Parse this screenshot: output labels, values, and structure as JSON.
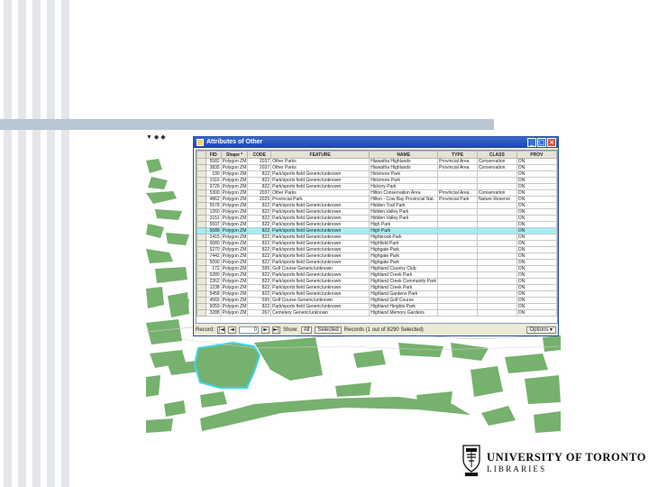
{
  "slide": {
    "colors": {
      "stripe": "#e3e6ea",
      "bar": "#b9c6d3",
      "map_fill": "#76b16e",
      "selection": "#3fd6e6"
    }
  },
  "map": {
    "toolbar_text": "▼ ◆ ◆"
  },
  "attr_window": {
    "title": "Attributes of Other",
    "buttons": {
      "minimize": "_",
      "maximize": "□",
      "close": "×"
    },
    "columns": [
      "FID",
      "Shape *",
      "CODE",
      "FEATURE",
      "NAME",
      "TYPE",
      "CLASS",
      "PROV"
    ],
    "rows": [
      [
        "5582",
        "Polygon ZM",
        "2037",
        "Other Parks",
        "Hiawatha Highlands",
        "Provincial Area",
        "Conservation",
        "ON"
      ],
      [
        "3835",
        "Polygon ZM",
        "2037",
        "Other Parks",
        "Hiawatha Highlands",
        "Provincial Area",
        "Conservation",
        "ON"
      ],
      [
        "190",
        "Polygon ZM",
        "822",
        "Park/sports field Generic/unknown",
        "Hickmore Park",
        "",
        "",
        "ON"
      ],
      [
        "3116",
        "Polygon ZM",
        "822",
        "Park/sports field Generic/unknown",
        "Hickmore Park",
        "",
        "",
        "ON"
      ],
      [
        "3726",
        "Polygon ZM",
        "822",
        "Park/sports field Generic/unknown",
        "Hickory Park",
        "",
        "",
        "ON"
      ],
      [
        "5300",
        "Polygon ZM",
        "2037",
        "Other Parks",
        "Hilton Conservation Area",
        "Provincial Area",
        "Conservation",
        "ON"
      ],
      [
        "4862",
        "Polygon ZM",
        "2025",
        "Provincial Park",
        "Hilton - Cow Bay Provincial Nat.",
        "Provincial Park",
        "Nature Reserve",
        "ON"
      ],
      [
        "5578",
        "Polygon ZM",
        "822",
        "Park/sports field Generic/unknown",
        "Hidden Trail Park",
        "",
        "",
        "ON"
      ],
      [
        "1260",
        "Polygon ZM",
        "822",
        "Park/sports field Generic/unknown",
        "Hidden Valley Park",
        "",
        "",
        "ON"
      ],
      [
        "3151",
        "Polygon ZM",
        "822",
        "Park/sports field Generic/unknown",
        "Hidden Valley Park",
        "",
        "",
        "ON"
      ],
      [
        "5597",
        "Polygon ZM",
        "822",
        "Park/sports field Generic/unknown",
        "High Park",
        "",
        "",
        "ON"
      ],
      [
        "5588",
        "Polygon ZM",
        "822",
        "Park/sports field Generic/unknown",
        "High Park",
        "",
        "",
        "ON"
      ],
      [
        "2415",
        "Polygon ZM",
        "822",
        "Park/sports field Generic/unknown",
        "Highbrook Park",
        "",
        "",
        "ON"
      ],
      [
        "0080",
        "Polygon ZM",
        "822",
        "Park/sports field Generic/unknown",
        "Highfield Park",
        "",
        "",
        "ON"
      ],
      [
        "5270",
        "Polygon ZM",
        "822",
        "Park/sports field Generic/unknown",
        "Highgate Park",
        "",
        "",
        "ON"
      ],
      [
        "7442",
        "Polygon ZM",
        "822",
        "Park/sports field Generic/unknown",
        "Highgate Park",
        "",
        "",
        "ON"
      ],
      [
        "5090",
        "Polygon ZM",
        "822",
        "Park/sports field Generic/unknown",
        "Highgate Park",
        "",
        "",
        "ON"
      ],
      [
        "172",
        "Polygon ZM",
        "595",
        "Golf Course Generic/unknown",
        "Highland Country Club",
        "",
        "",
        "ON"
      ],
      [
        "5280",
        "Polygon ZM",
        "822",
        "Park/sports field Generic/unknown",
        "Highland Creek Park",
        "",
        "",
        "ON"
      ],
      [
        "2362",
        "Polygon ZM",
        "822",
        "Park/sports field Generic/unknown",
        "Highland Creek Community Park",
        "",
        "",
        "ON"
      ],
      [
        "1238",
        "Polygon ZM",
        "822",
        "Park/sports field Generic/unknown",
        "Highland Creek Park",
        "",
        "",
        "ON"
      ],
      [
        "5458",
        "Polygon ZM",
        "822",
        "Park/sports field Generic/unknown",
        "Highland Gardens Park",
        "",
        "",
        "ON"
      ],
      [
        "4565",
        "Polygon ZM",
        "595",
        "Golf Course Generic/unknown",
        "Highland Golf Course",
        "",
        "",
        "ON"
      ],
      [
        "5059",
        "Polygon ZM",
        "822",
        "Park/sports field Generic/unknown",
        "Highland Heights Park",
        "",
        "",
        "ON"
      ],
      [
        "3288",
        "Polygon ZM",
        "267",
        "Cemetery Generic/unknown",
        "Highland Memory Gardens",
        "",
        "",
        "ON"
      ]
    ],
    "selected_row_index": 11,
    "status": {
      "record_label": "Record:",
      "first": "|◄",
      "prev": "◄",
      "record_value": "0",
      "next": "►",
      "last": "►|",
      "show_label": "Show:",
      "all_btn": "All",
      "selected_btn": "Selected",
      "records_text": "Records (1 out of 8290 Selected)",
      "options_btn": "Options ▾"
    }
  },
  "logo": {
    "university": "UNIVERSITY OF TORONTO",
    "libraries": "LIBRARIES"
  }
}
